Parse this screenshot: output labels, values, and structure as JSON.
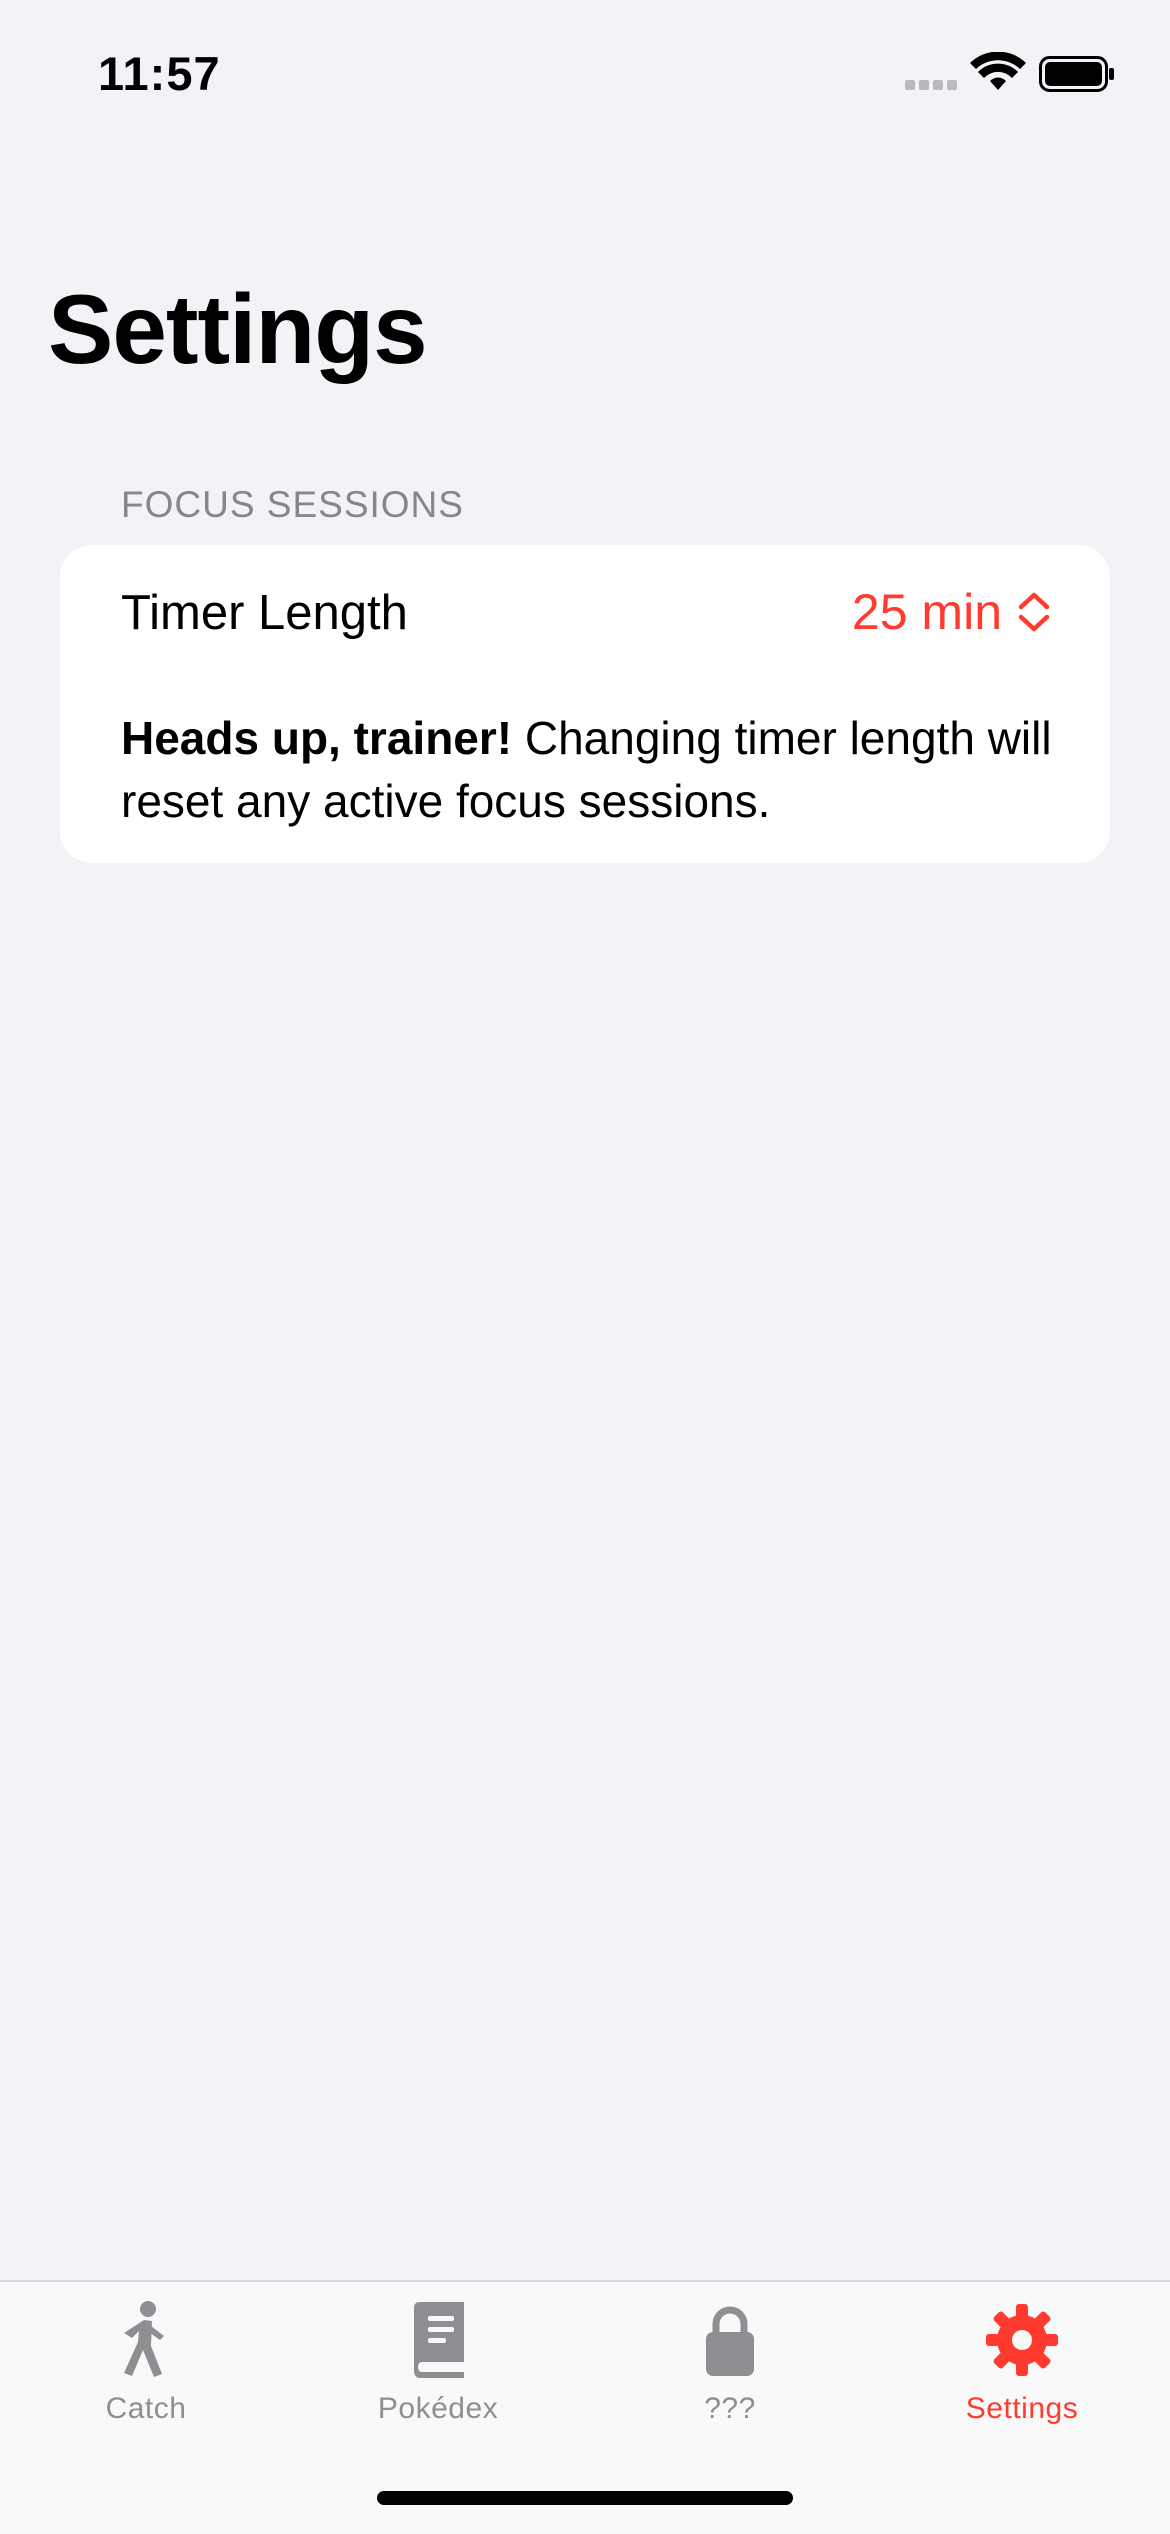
{
  "status_bar": {
    "time": "11:57"
  },
  "header": {
    "title": "Settings"
  },
  "section": {
    "header": "FOCUS SESSIONS",
    "timer_row": {
      "label": "Timer Length",
      "value": "25 min"
    },
    "note": {
      "bold": "Heads up, trainer!",
      "text": " Changing timer length will reset any active focus sessions."
    }
  },
  "tab_bar": {
    "tabs": [
      {
        "label": "Catch",
        "icon": "walk-icon"
      },
      {
        "label": "Pokédex",
        "icon": "book-icon"
      },
      {
        "label": "???",
        "icon": "lock-icon"
      },
      {
        "label": "Settings",
        "icon": "gear-icon"
      }
    ],
    "selected": "Settings"
  },
  "colors": {
    "accent": "#ff3b30",
    "background": "#f2f2f7",
    "inactive": "#8e8e93"
  }
}
